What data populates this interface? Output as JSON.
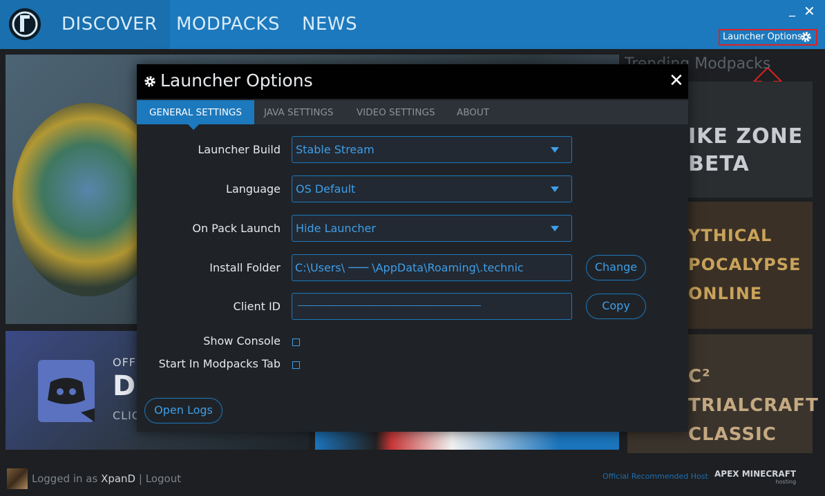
{
  "nav": {
    "items": [
      {
        "label": "DISCOVER",
        "active": true
      },
      {
        "label": "MODPACKS",
        "active": false
      },
      {
        "label": "NEWS",
        "active": false
      }
    ]
  },
  "window": {
    "minimize": "_",
    "close": "✕"
  },
  "launcher_options_button": {
    "label": "Launcher Options",
    "icon": "gear-icon"
  },
  "background": {
    "discord": {
      "line1": "OFFI",
      "line2": "D",
      "line3": "CLIC"
    },
    "trending_title": "Trending Modpacks",
    "trending": [
      {
        "text": "IKE ZONE\nBETA"
      },
      {
        "text": "YTHICAL\nPOCALYPSE\nONLINE"
      },
      {
        "text": "C²\nTRIALCRAFT\nCLASSIC"
      }
    ]
  },
  "modal": {
    "title": "Launcher Options",
    "close": "✕",
    "tabs": [
      {
        "label": "GENERAL SETTINGS",
        "active": true
      },
      {
        "label": "JAVA SETTINGS",
        "active": false
      },
      {
        "label": "VIDEO SETTINGS",
        "active": false
      },
      {
        "label": "ABOUT",
        "active": false
      }
    ],
    "fields": {
      "launcher_build": {
        "label": "Launcher Build",
        "value": "Stable Stream"
      },
      "language": {
        "label": "Language",
        "value": "OS Default"
      },
      "on_pack_launch": {
        "label": "On Pack Launch",
        "value": "Hide Launcher"
      },
      "install_folder": {
        "label": "Install Folder",
        "value": "C:\\Users\\ ─── \\AppData\\Roaming\\.technic",
        "button": "Change"
      },
      "client_id": {
        "label": "Client ID",
        "value": "────────────────────────────────────────────",
        "button": "Copy"
      },
      "show_console": {
        "label": "Show Console",
        "checked": false
      },
      "start_in_modpacks": {
        "label": "Start In Modpacks Tab",
        "checked": false
      }
    },
    "open_logs": "Open Logs"
  },
  "footer": {
    "logged_in_prefix": "Logged in as",
    "username": "XpanD",
    "separator": "|",
    "logout": "Logout",
    "host_text": "Official Recommended Host",
    "apex_brand": "APEX MINECRAFT",
    "apex_sub": "hosting"
  },
  "colors": {
    "accent": "#1d79bd",
    "link": "#3f9ee8",
    "highlight_box": "#e02020"
  }
}
